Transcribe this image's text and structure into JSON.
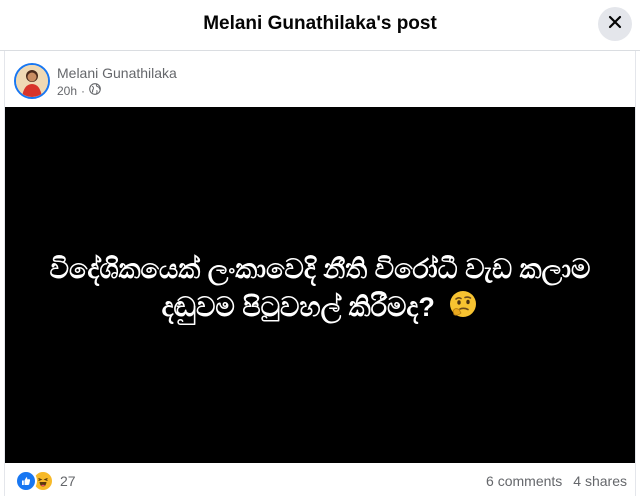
{
  "header": {
    "title": "Melani Gunathilaka's post",
    "close_icon": "close-icon"
  },
  "post": {
    "author": "Melani Gunathilaka",
    "time": "20h",
    "separator": "·",
    "audience_icon": "globe-icon",
    "text": "විදේශිකයෙක් ලංකාවෙදි නීති විරෝධී වැඩ කලාම දඬුවම පිටුවහල් කිරීමද?",
    "emoji": "🤔",
    "background_color": "#000000"
  },
  "footer": {
    "reaction_icons": [
      "like-icon",
      "haha-icon"
    ],
    "reaction_count": "27",
    "comments": "6 comments",
    "shares": "4 shares"
  },
  "colors": {
    "accent": "#1877f2",
    "secondary_text": "#65676b",
    "haha": "#f7b928"
  }
}
